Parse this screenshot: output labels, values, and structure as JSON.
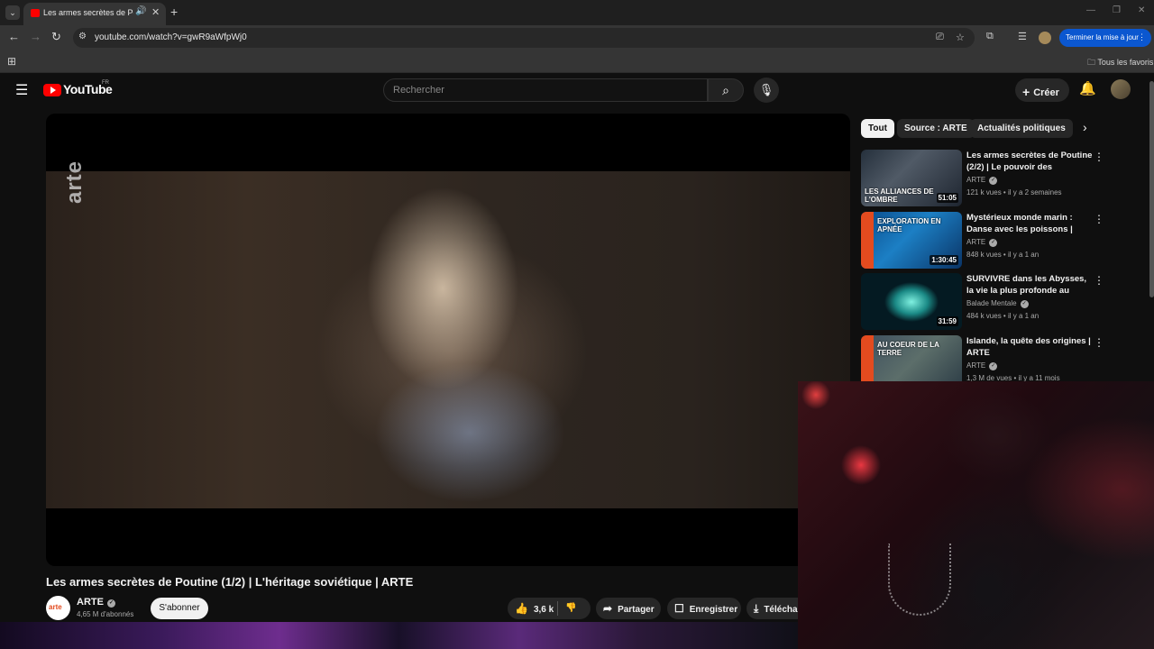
{
  "browser": {
    "tab_title": "Les armes secrètes de Poutine",
    "url": "youtube.com/watch?v=gwR9aWfpWj0",
    "update_label": "Terminer la mise à jour",
    "bookmarks_all": "Tous les favoris"
  },
  "header": {
    "logo_text": "YouTube",
    "country": "FR",
    "search_placeholder": "Rechercher",
    "create_label": "Créer"
  },
  "video": {
    "watermark": "arte",
    "title": "Les armes secrètes de Poutine (1/2) | L'héritage soviétique | ARTE",
    "channel": "ARTE",
    "channel_avatar_text": "arte",
    "subscribers": "4,65 M d'abonnés",
    "subscribe_label": "S'abonner",
    "likes": "3,6 k",
    "share_label": "Partager",
    "save_label": "Enregistrer",
    "download_label": "Téléchar"
  },
  "chips": [
    "Tout",
    "Source : ARTE",
    "Actualités politiques"
  ],
  "recommendations": [
    {
      "title": "Les armes secrètes de Poutine (2/2) | Le pouvoir des nouvelle...",
      "channel": "ARTE",
      "meta": "121 k vues • il y a 2 semaines",
      "duration": "51:05",
      "thumb_text": "LES ALLIANCES DE L'OMBRE"
    },
    {
      "title": "Mystérieux monde marin : Danse avec les poissons | ARTE",
      "channel": "ARTE",
      "meta": "848 k vues • il y a 1 an",
      "duration": "1:30:45",
      "thumb_text": "EXPLORATION EN APNÉE"
    },
    {
      "title": "SURVIVRE dans les Abysses, la vie la plus profonde au monde",
      "channel": "Balade Mentale",
      "meta": "484 k vues • il y a 1 an",
      "duration": "31:59",
      "thumb_text": ""
    },
    {
      "title": "Islande, la quête des origines | ARTE",
      "channel": "ARTE",
      "meta": "1,3 M de vues • il y a 11 mois",
      "duration": "",
      "thumb_text": "AU COEUR DE LA TERRE"
    }
  ],
  "colors": {
    "yt_red": "#ff0000",
    "arte_orange": "#e34b1f",
    "update_blue": "#0b57d0"
  }
}
